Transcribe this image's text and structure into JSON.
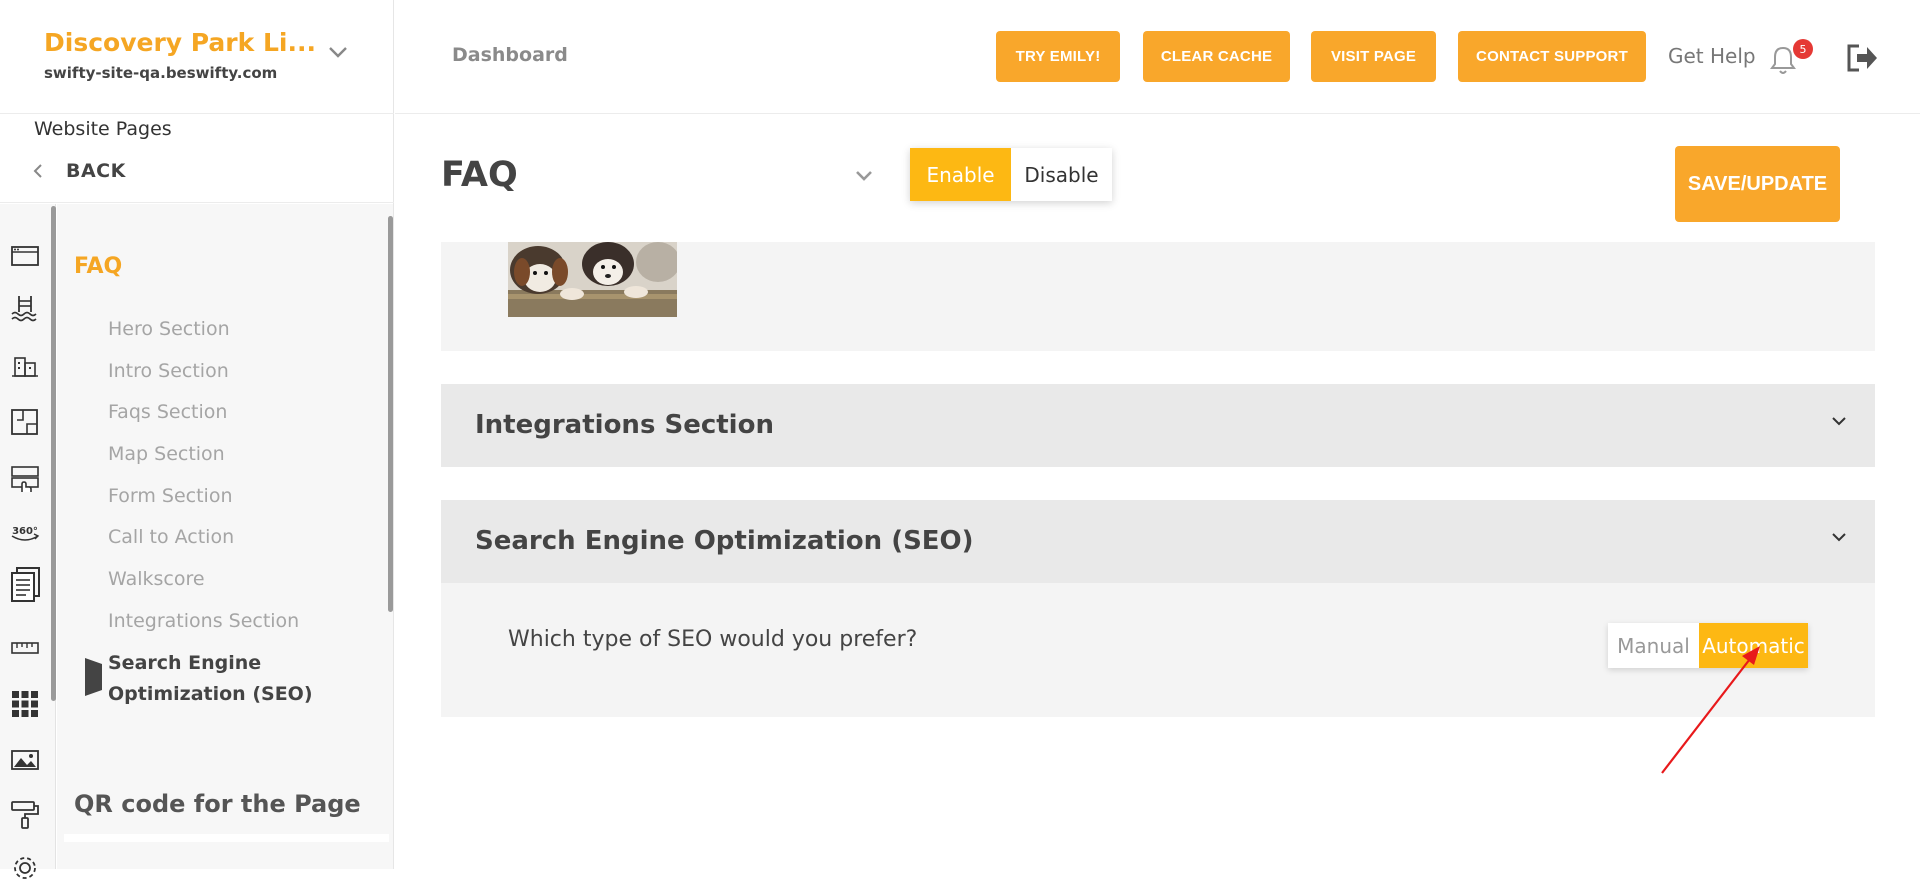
{
  "brand": {
    "name": "Discovery Park Li...",
    "url": "swifty-site-qa.beswifty.com"
  },
  "sidebar": {
    "pages_label": "Website Pages",
    "back_label": "BACK",
    "page_name": "FAQ",
    "sections": [
      {
        "label": "Hero Section"
      },
      {
        "label": "Intro Section"
      },
      {
        "label": "Faqs Section"
      },
      {
        "label": "Map Section"
      },
      {
        "label": "Form Section"
      },
      {
        "label": "Call to Action"
      },
      {
        "label": "Walkscore"
      },
      {
        "label": "Integrations Section"
      },
      {
        "label": "Search Engine Optimization (SEO)",
        "active": true
      }
    ],
    "qr_title": "QR code for the Page",
    "rail_icons": [
      "browser-window-icon",
      "pool-icon",
      "buildings-icon",
      "floorplan-icon",
      "amenities-icon",
      "360-view-icon",
      "document-pages-icon",
      "ruler-icon",
      "grid-apps-icon",
      "image-gallery-icon",
      "paint-roller-icon",
      "settings-gear-icon"
    ]
  },
  "header": {
    "breadcrumb": "Dashboard",
    "buttons": {
      "try_emily": "TRY EMILY!",
      "clear_cache": "CLEAR CACHE",
      "visit_page": "VISIT PAGE",
      "contact_support": "CONTACT SUPPORT"
    },
    "get_help": "Get Help",
    "notifications_count": "5"
  },
  "page": {
    "title": "FAQ",
    "enable_label": "Enable",
    "disable_label": "Disable",
    "status": "Enable",
    "save_label": "SAVE/UPDATE"
  },
  "panels": {
    "integrations_title": "Integrations Section",
    "seo_title": "Search Engine Optimization (SEO)",
    "seo_question": "Which type of SEO would you prefer?",
    "seo_manual": "Manual",
    "seo_automatic": "Automatic",
    "seo_selected": "Automatic"
  },
  "colors": {
    "accent": "#f9a72b",
    "toggle_active": "#fdb813",
    "brand": "#f5a623",
    "badge": "#e53935",
    "annotation_arrow": "#e8191b"
  }
}
